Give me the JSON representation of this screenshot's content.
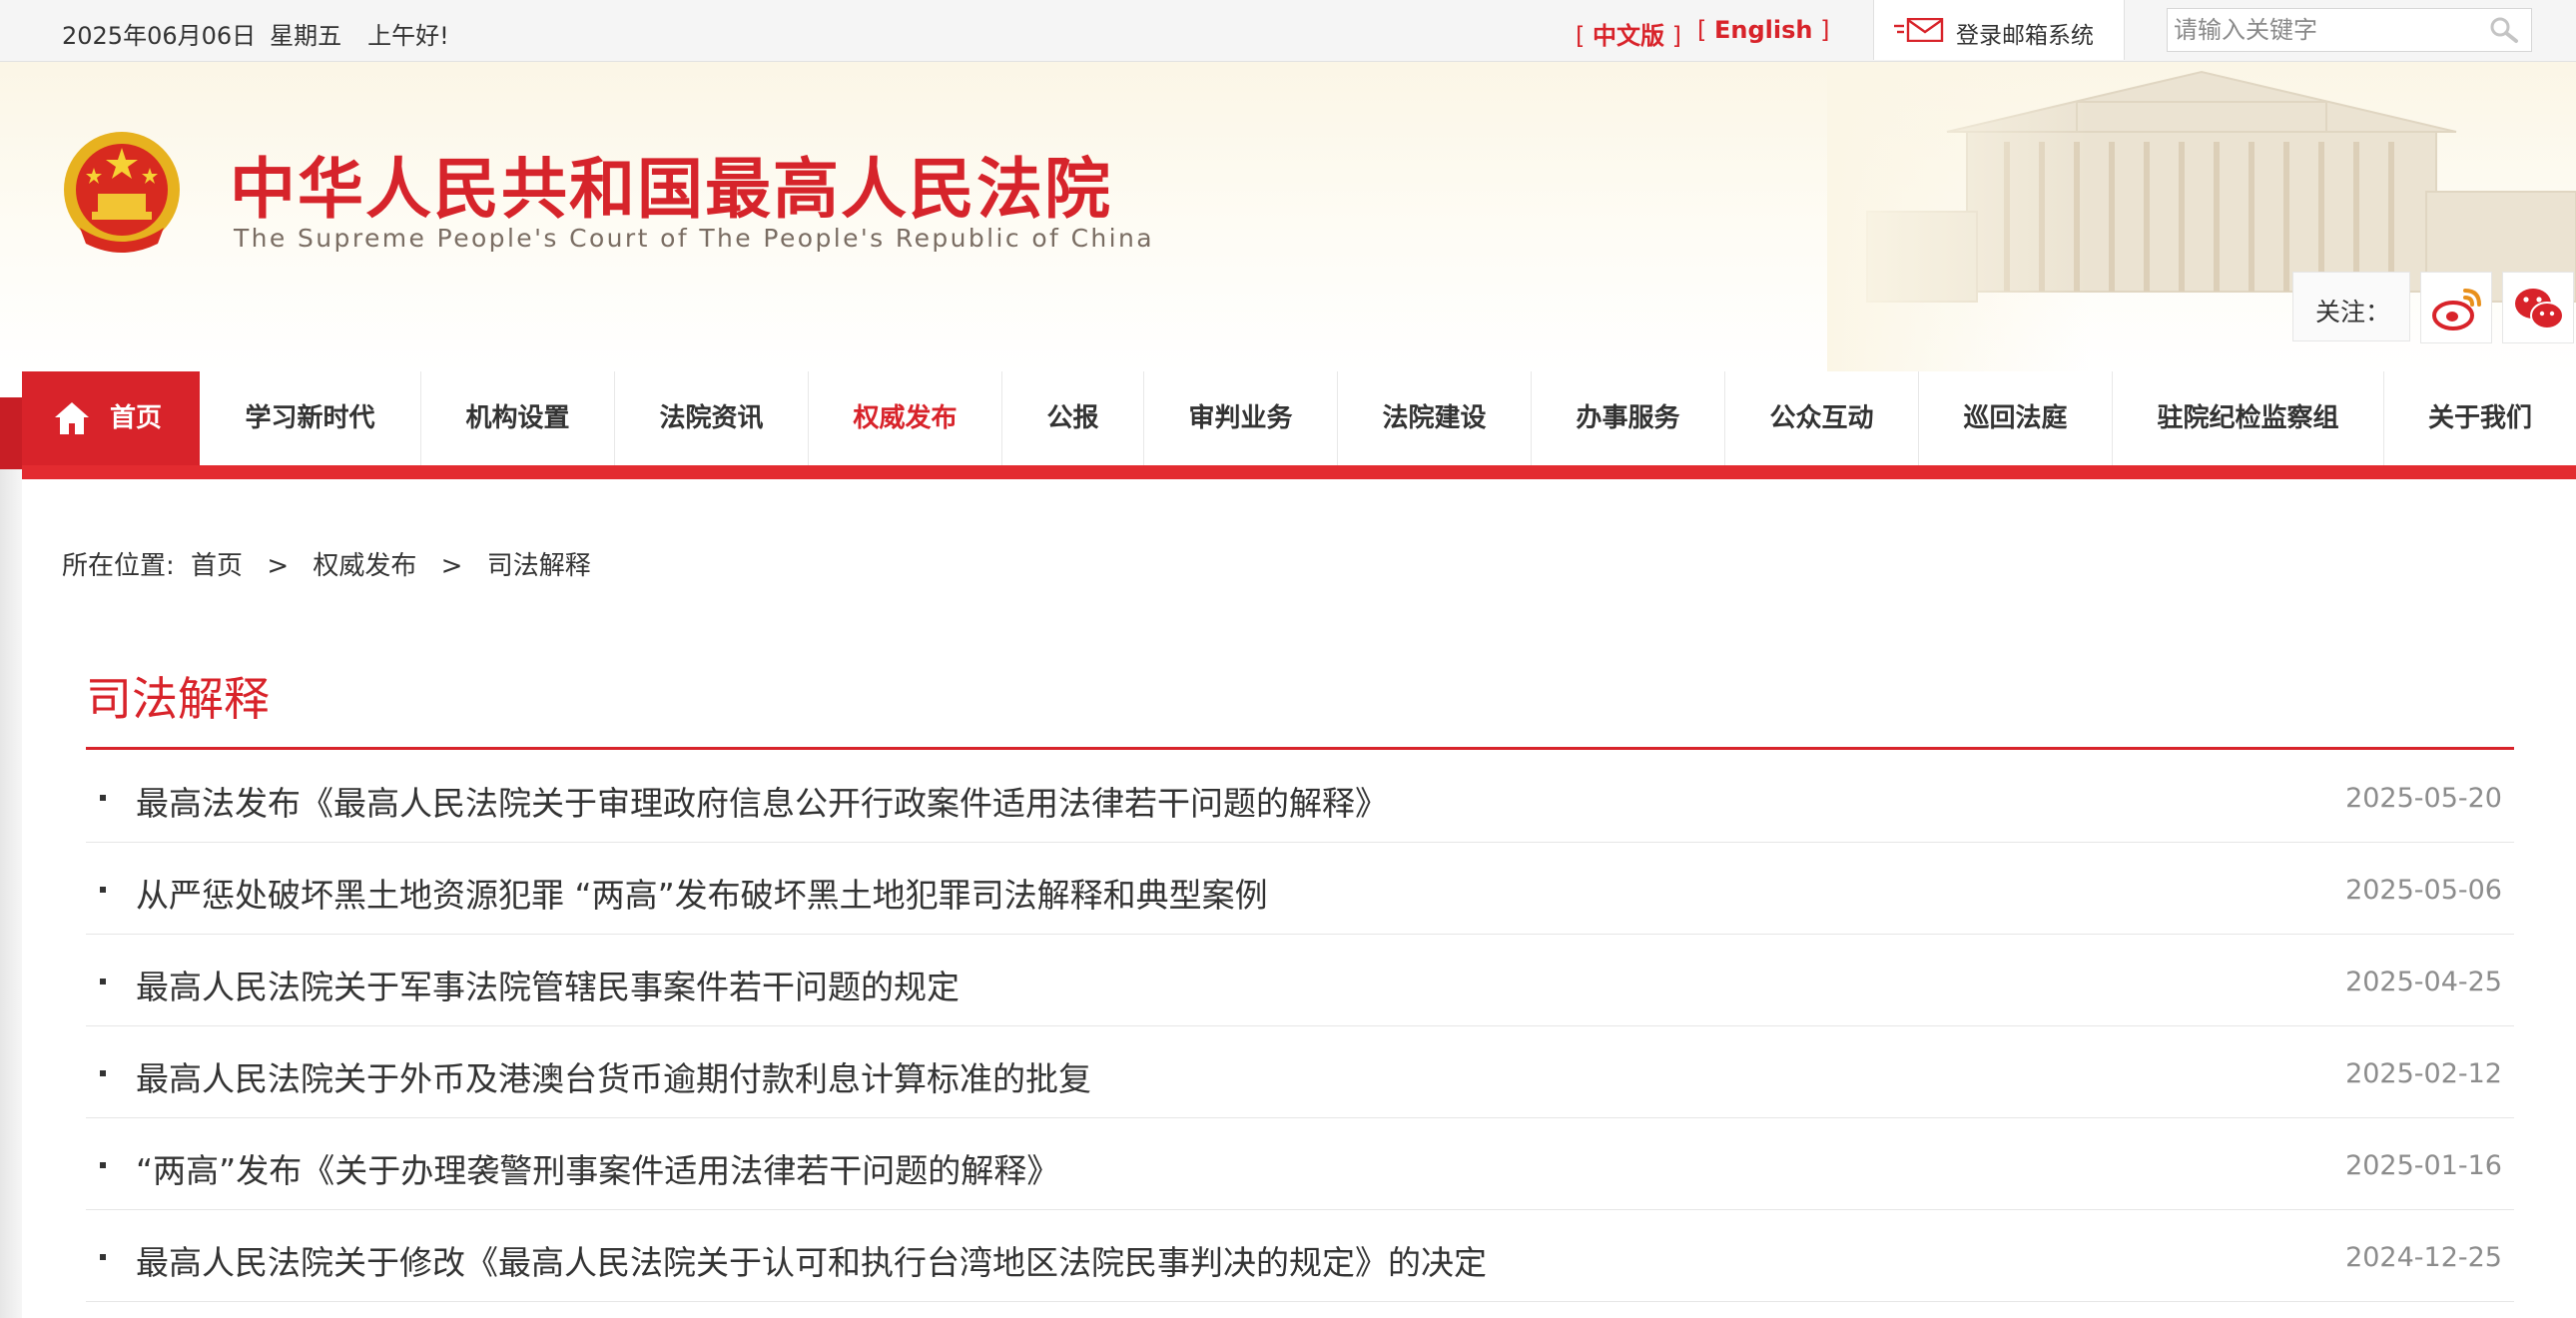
{
  "topbar": {
    "date": "2025年06月06日",
    "weekday": "星期五",
    "greeting": "上午好!",
    "lang_zh": "中文版",
    "lang_en": "English",
    "mailbox_label": "登录邮箱系统",
    "search_placeholder": "请输入关键字"
  },
  "header": {
    "title": "中华人民共和国最高人民法院",
    "subtitle": "The Supreme People's Court of The People's Republic of China",
    "follow_label": "关注：",
    "social": [
      "weibo-icon",
      "wechat-icon"
    ]
  },
  "nav": {
    "items": [
      {
        "label": "首页",
        "active": true,
        "home": true
      },
      {
        "label": "学习新时代"
      },
      {
        "label": "机构设置"
      },
      {
        "label": "法院资讯"
      },
      {
        "label": "权威发布",
        "highlight": true
      },
      {
        "label": "公报"
      },
      {
        "label": "审判业务"
      },
      {
        "label": "法院建设"
      },
      {
        "label": "办事服务"
      },
      {
        "label": "公众互动"
      },
      {
        "label": "巡回法庭"
      },
      {
        "label": "驻院纪检监察组"
      },
      {
        "label": "关于我们"
      }
    ]
  },
  "breadcrumb": {
    "prefix": "所在位置:",
    "items": [
      "首页",
      "权威发布",
      "司法解释"
    ],
    "separator": ">"
  },
  "section": {
    "title": "司法解释",
    "items": [
      {
        "title": "最高法发布《最高人民法院关于审理政府信息公开行政案件适用法律若干问题的解释》",
        "date": "2025-05-20"
      },
      {
        "title": "从严惩处破坏黑土地资源犯罪 “两高”发布破坏黑土地犯罪司法解释和典型案例",
        "date": "2025-05-06"
      },
      {
        "title": "最高人民法院关于军事法院管辖民事案件若干问题的规定",
        "date": "2025-04-25"
      },
      {
        "title": "最高人民法院关于外币及港澳台货币逾期付款利息计算标准的批复",
        "date": "2025-02-12"
      },
      {
        "title": "“两高”发布《关于办理袭警刑事案件适用法律若干问题的解释》",
        "date": "2025-01-16"
      },
      {
        "title": "最高人民法院关于修改《最高人民法院关于认可和执行台湾地区法院民事判决的规定》的决定",
        "date": "2024-12-25"
      }
    ]
  },
  "colors": {
    "brand_red": "#d8232a",
    "nav_bar_red": "#e32b30",
    "date_gray": "#8c8c8c"
  }
}
